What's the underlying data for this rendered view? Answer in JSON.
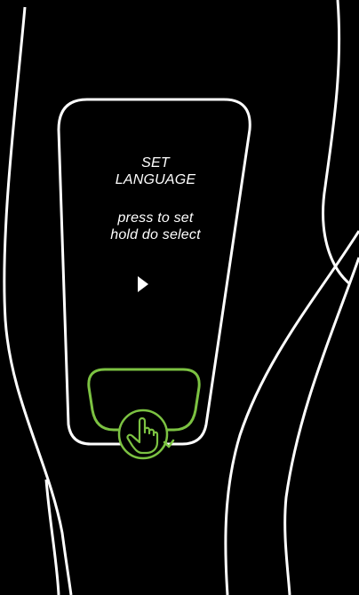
{
  "screen": {
    "title_line1": "SET",
    "title_line2": "LANGUAGE",
    "instruction_line1": "press to set",
    "instruction_line2": "hold do select"
  },
  "icons": {
    "next": "play-triangle-icon",
    "button": "press-hold-hand-icon"
  },
  "colors": {
    "background": "#000000",
    "outline": "#ffffff",
    "accent": "#7cc242"
  }
}
